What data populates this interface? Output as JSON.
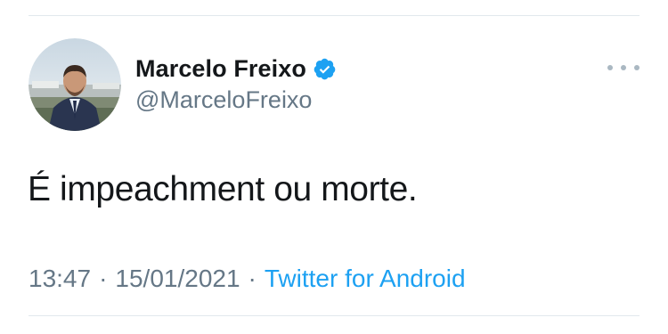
{
  "tweet": {
    "author": {
      "display_name": "Marcelo Freixo",
      "handle": "@MarceloFreixo",
      "verified": true,
      "verified_icon": "verified-badge-icon"
    },
    "text": "É impeachment ou morte.",
    "time": "13:47",
    "separator": "·",
    "date": "15/01/2021",
    "source": "Twitter for Android"
  },
  "colors": {
    "text_primary": "#14171a",
    "text_secondary": "#657786",
    "accent": "#1da1f2",
    "divider": "#e1e8ed"
  }
}
